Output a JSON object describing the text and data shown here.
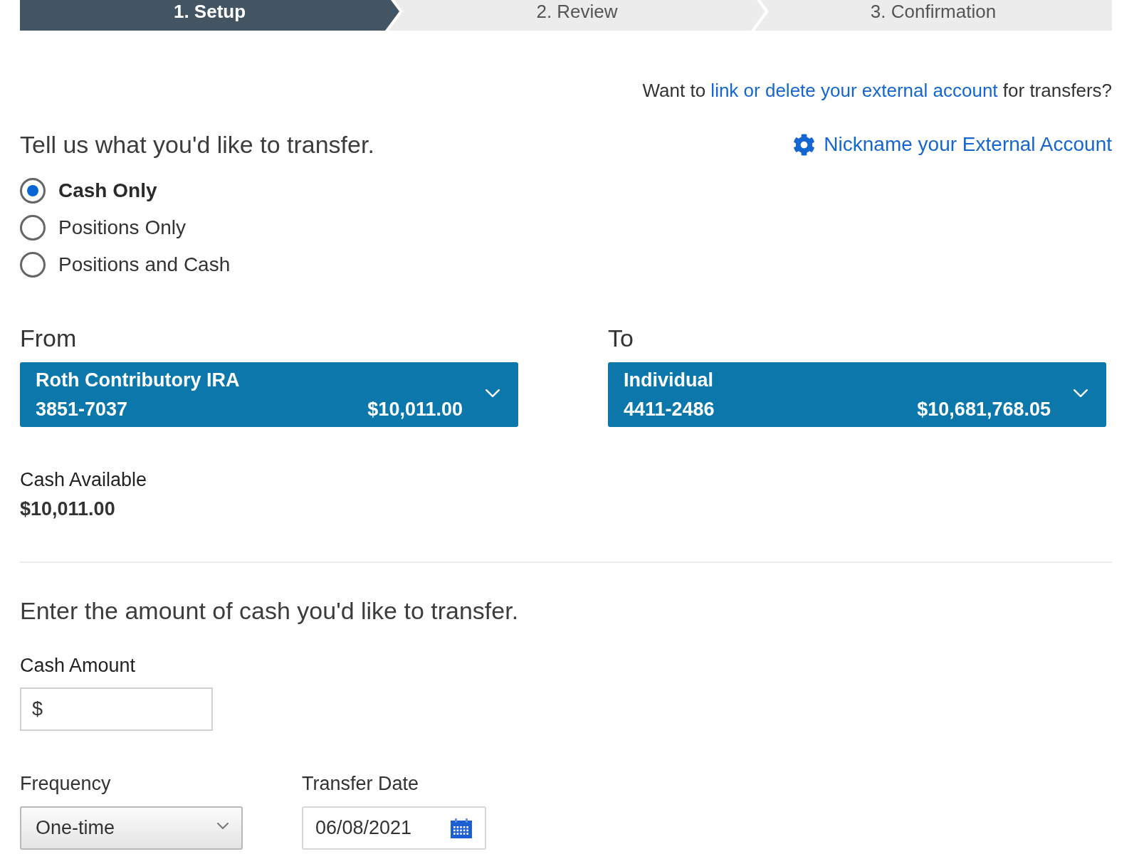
{
  "steps": [
    {
      "label": "1. Setup",
      "selected": true
    },
    {
      "label": "2. Review",
      "selected": false
    },
    {
      "label": "3. Confirmation",
      "selected": false
    }
  ],
  "external_account_prompt": {
    "before": "Want to",
    "link": "link or delete your external account",
    "after": "for transfers?"
  },
  "transfer_type": {
    "heading": "Tell us what you'd like to transfer.",
    "nickname_link": "Nickname your External Account",
    "options": [
      {
        "label": "Cash Only",
        "selected": true
      },
      {
        "label": "Positions Only",
        "selected": false
      },
      {
        "label": "Positions and Cash",
        "selected": false
      }
    ]
  },
  "accounts": [
    {
      "label": "From",
      "name": "Roth Contributory IRA",
      "number": "3851-7037",
      "balance": "$10,011.00"
    },
    {
      "label": "To",
      "name": "Individual",
      "number": "4411-2486",
      "balance": "$10,681,768.05"
    }
  ],
  "cash_available": {
    "label": "Cash Available",
    "value": "$10,011.00"
  },
  "amount_section": {
    "heading": "Enter the amount of cash you'd like to transfer.",
    "cash_amount": {
      "label": "Cash Amount",
      "prefix": "$"
    },
    "frequency": {
      "label": "Frequency",
      "value": "One-time"
    },
    "transfer_date": {
      "label": "Transfer Date",
      "value": "06/08/2021"
    }
  }
}
